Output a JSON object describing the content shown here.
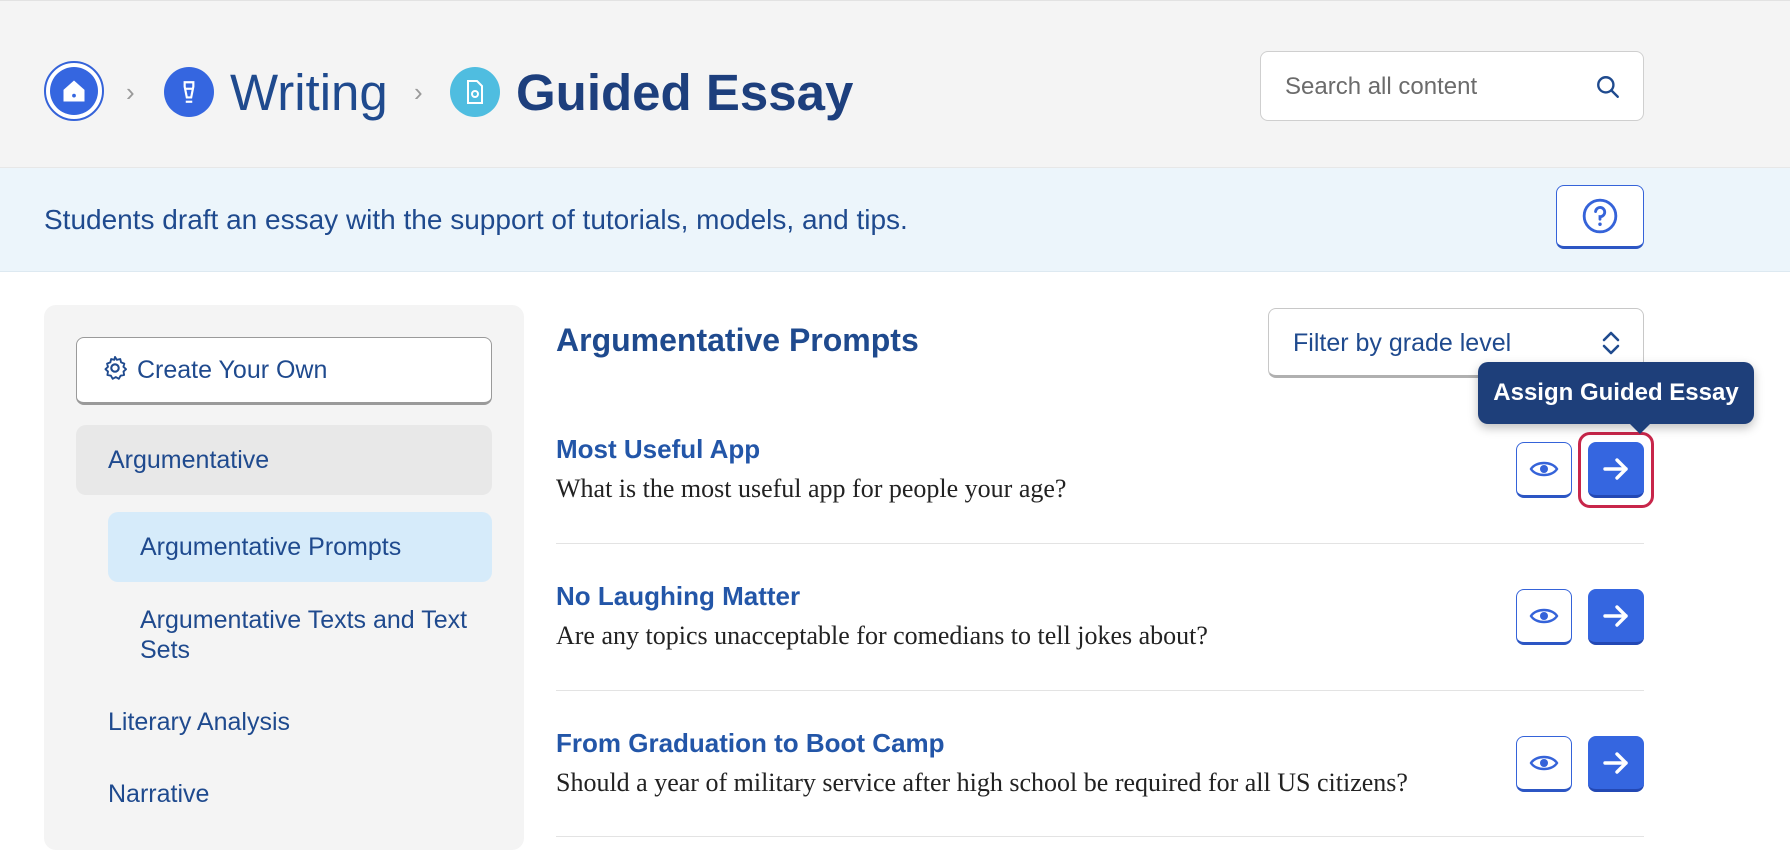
{
  "breadcrumb": {
    "items": [
      {
        "label": "Writing"
      },
      {
        "label": "Guided Essay"
      }
    ]
  },
  "search": {
    "placeholder": "Search all content"
  },
  "banner": {
    "description": "Students draft an essay with the support of tutorials, models, and tips."
  },
  "sidebar": {
    "create_label": "Create Your Own",
    "items": [
      {
        "label": "Argumentative"
      },
      {
        "label": "Argumentative Prompts"
      },
      {
        "label": "Argumentative Texts and Text Sets"
      },
      {
        "label": "Literary Analysis"
      },
      {
        "label": "Narrative"
      }
    ]
  },
  "main": {
    "section_title": "Argumentative Prompts",
    "filter_label": "Filter by grade level",
    "tooltip": "Assign Guided Essay",
    "prompts": [
      {
        "title": "Most Useful App",
        "description": "What is the most useful app for people your age?"
      },
      {
        "title": "No Laughing Matter",
        "description": "Are any topics unacceptable for comedians to tell jokes about?"
      },
      {
        "title": "From Graduation to Boot Camp",
        "description": "Should a year of military service after high school be required for all US citizens?"
      }
    ]
  },
  "colors": {
    "accent": "#3566e0",
    "navy": "#1e3f7a",
    "focus": "#c8264a",
    "banner_bg": "#ecf5fb"
  },
  "icons": [
    "home-icon",
    "pen-icon",
    "document-icon",
    "search-icon",
    "help-icon",
    "gear-icon",
    "sort-icon",
    "eye-icon",
    "arrow-right-icon"
  ]
}
